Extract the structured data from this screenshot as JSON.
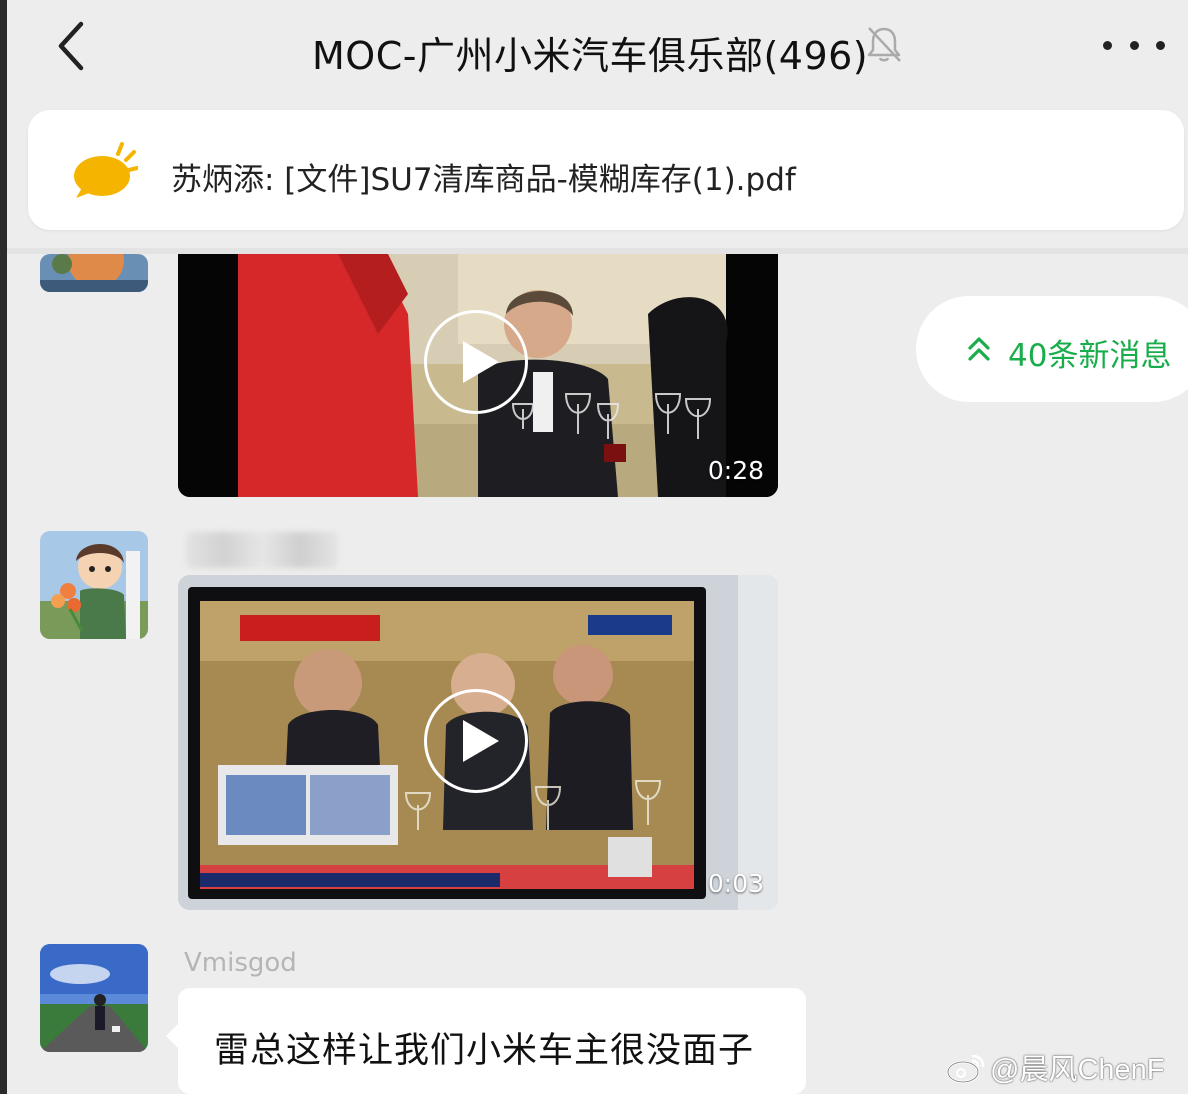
{
  "header": {
    "title": "MOC-广州小米汽车俱乐部(496)",
    "back_icon": "chevron-left-icon",
    "mute_icon": "bell-off-icon",
    "more_icon": "more-dots-icon"
  },
  "pinned": {
    "icon": "megaphone-icon",
    "text": "苏炳添: [文件]SU7清库商品-模糊库存(1).pdf"
  },
  "new_messages": {
    "icon": "double-chevron-up-icon",
    "label": "40条新消息"
  },
  "messages": [
    {
      "type": "video",
      "duration": "0:28"
    },
    {
      "type": "video",
      "duration": "0:03"
    },
    {
      "type": "text",
      "sender": "Vmisgod",
      "text": "雷总这样让我们小米车主很没面子"
    }
  ],
  "watermark": {
    "logo": "weibo-icon",
    "text": "@晨风ChenF"
  },
  "colors": {
    "accent": "#1aad4c",
    "background": "#ededed",
    "bubble": "#ffffff"
  }
}
